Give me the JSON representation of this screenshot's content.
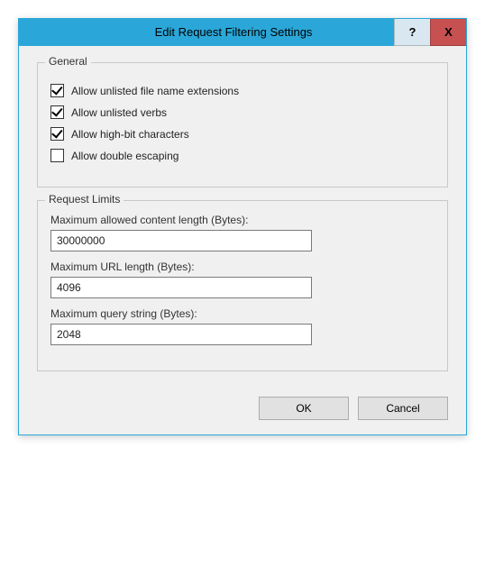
{
  "titlebar": {
    "title": "Edit Request Filtering Settings",
    "help_label": "?",
    "close_label": "X"
  },
  "general": {
    "legend": "General",
    "allow_unlisted_ext": {
      "label": "Allow unlisted file name extensions",
      "checked": true
    },
    "allow_unlisted_verbs": {
      "label": "Allow unlisted verbs",
      "checked": true
    },
    "allow_high_bit": {
      "label": "Allow high-bit characters",
      "checked": true
    },
    "allow_double_escaping": {
      "label": "Allow double escaping",
      "checked": false
    }
  },
  "request_limits": {
    "legend": "Request Limits",
    "max_content_length": {
      "label": "Maximum allowed content length (Bytes):",
      "value": "30000000"
    },
    "max_url_length": {
      "label": "Maximum URL length (Bytes):",
      "value": "4096"
    },
    "max_query_string": {
      "label": "Maximum query string (Bytes):",
      "value": "2048"
    }
  },
  "buttons": {
    "ok": "OK",
    "cancel": "Cancel"
  }
}
